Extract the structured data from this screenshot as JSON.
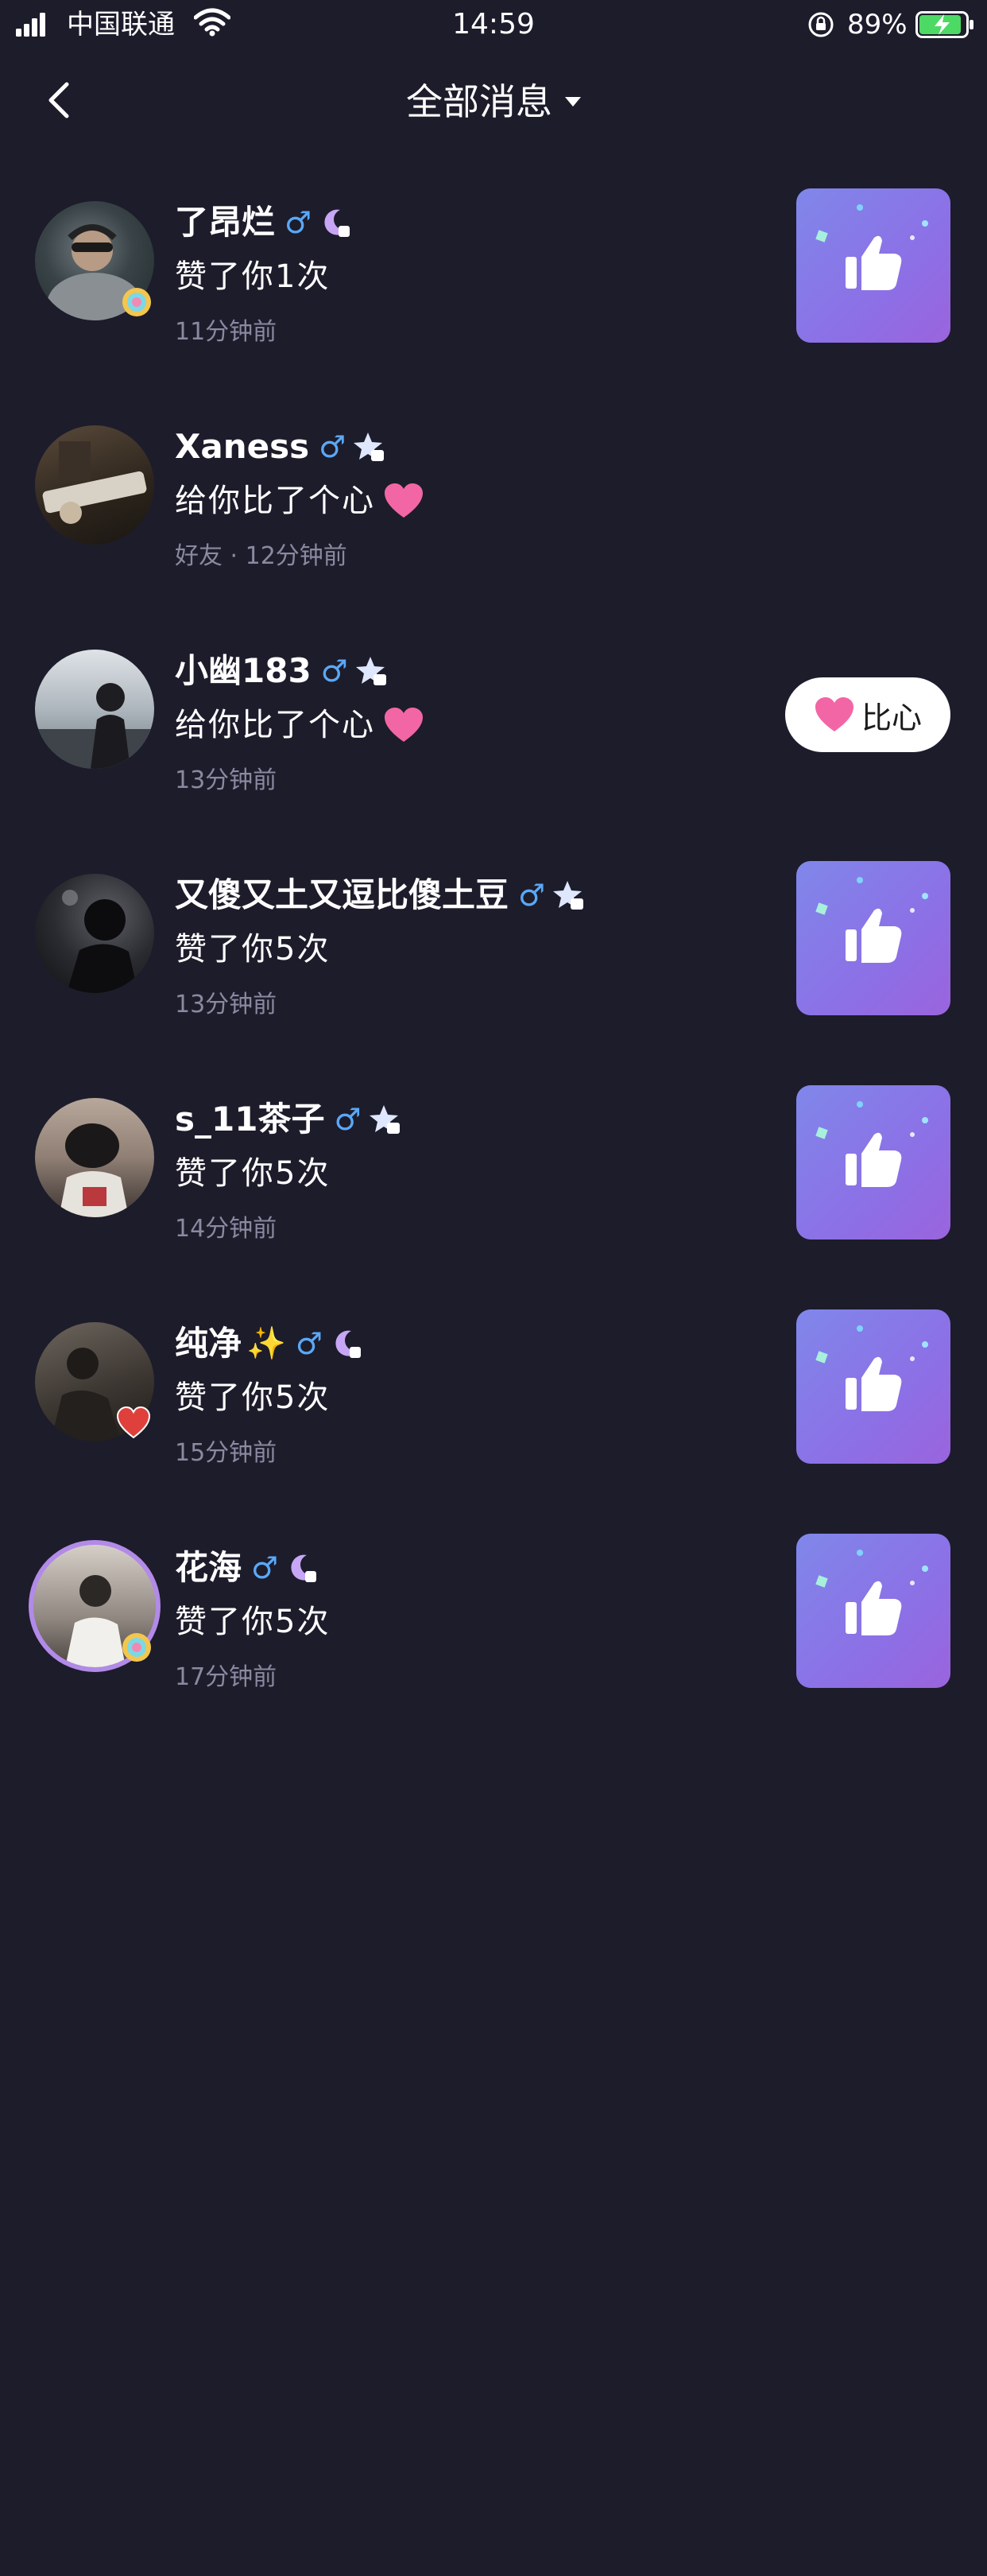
{
  "status_bar": {
    "carrier": "中国联通",
    "time": "14:59",
    "battery": "89%"
  },
  "nav": {
    "title": "全部消息"
  },
  "messages": [
    {
      "name": "了昂烂",
      "level_icon": "moon-level-6",
      "action": "赞了你1次",
      "time": "11分钟前",
      "type": "like"
    },
    {
      "name": "Xaness",
      "level_icon": "star-level-10",
      "action": "给你比了个心",
      "time": "好友 · 12分钟前",
      "type": "heart"
    },
    {
      "name": "小幽183",
      "level_icon": "star-level-3",
      "action": "给你比了个心",
      "time": "13分钟前",
      "type": "heart-button",
      "button_label": "比心"
    },
    {
      "name": "又傻又土又逗比傻土豆",
      "level_icon": "star-level-10",
      "action": "赞了你5次",
      "time": "13分钟前",
      "type": "like"
    },
    {
      "name": "s_11茶子",
      "level_icon": "star-level-8",
      "action": "赞了你5次",
      "time": "14分钟前",
      "type": "like"
    },
    {
      "name": "纯净",
      "level_icon": "moon-level-6",
      "action": "赞了你5次",
      "time": "15分钟前",
      "type": "like"
    },
    {
      "name": "花海",
      "level_icon": "moon-level-6",
      "action": "赞了你5次",
      "time": "17分钟前",
      "type": "like"
    }
  ],
  "colors": {
    "background": "#1d1c2b",
    "muted_text": "#8a89a0",
    "male_blue": "#5aa8f7",
    "like_gradient_start": "#8087ea",
    "like_gradient_end": "#9a64dd",
    "heart_pink": "#f266a5"
  },
  "icons": {
    "back": "chevron-left-icon",
    "dropdown": "caret-down-icon",
    "like": "thumbs-up-icon",
    "heart": "heart-icon",
    "male": "male-symbol-icon"
  }
}
